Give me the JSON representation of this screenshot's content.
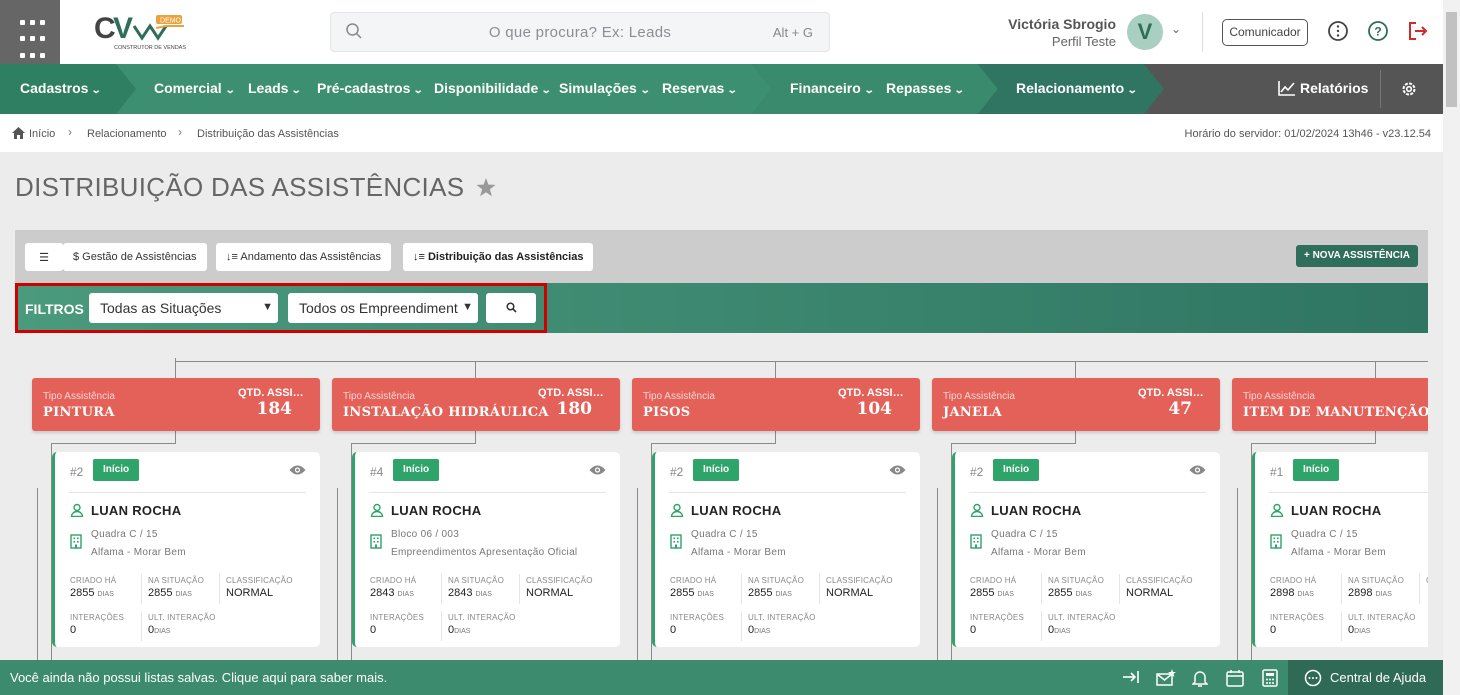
{
  "search": {
    "placeholder": "O que procura? Ex: Leads",
    "shortcut": "Alt + G"
  },
  "user": {
    "name": "Victória Sbrogio",
    "profile": "Perfil Teste",
    "initial": "V"
  },
  "header": {
    "comunicador": "Comunicador"
  },
  "nav": {
    "items": [
      "Cadastros",
      "Comercial",
      "Leads",
      "Pré-cadastros",
      "Disponibilidade",
      "Simulações",
      "Reservas",
      "Financeiro",
      "Repasses",
      "Relacionamento"
    ],
    "relatorios": "Relatórios"
  },
  "breadcrumb": [
    "Início",
    "Relacionamento",
    "Distribuição das Assistências"
  ],
  "server_time": "Horário do servidor: 01/02/2024 13h46 - v23.12.54",
  "page_title": "DISTRIBUIÇÃO DAS ASSISTÊNCIAS",
  "tabs": [
    "$ Gestão de Assistências",
    "↓≡ Andamento das Assistências",
    "↓≡ Distribuição das Assistências"
  ],
  "nova_assistencia": "+ NOVA ASSISTÊNCIA",
  "filters": {
    "label": "FILTROS",
    "situacoes": "Todas as Situações",
    "empreendimentos": "Todos os Empreendiment"
  },
  "group_labels": {
    "tipo": "Tipo Assistência",
    "qtd": "QTD. ASSISTÊNCIAS"
  },
  "metric_labels": {
    "criado": "CRIADO HÁ",
    "na_situacao": "NA SITUAÇÃO",
    "classificacao": "CLASSIFICAÇÃO",
    "interacoes": "INTERAÇÕES",
    "ult_interacao": "ULT. INTERAÇÃO",
    "dias": "DIAS"
  },
  "groups": [
    {
      "tipo": "PINTURA",
      "qtd": "184",
      "card": {
        "num": "#2",
        "status": "Início",
        "name": "LUAN ROCHA",
        "unit": "Quadra C / 15",
        "project": "Alfama - Morar Bem",
        "criado": "2855",
        "situacao": "2855",
        "classificacao": "NORMAL",
        "interacoes": "0",
        "ult": "0"
      }
    },
    {
      "tipo": "INSTALAÇÃO HIDRÁULICA",
      "qtd": "180",
      "card": {
        "num": "#4",
        "status": "Início",
        "name": "LUAN ROCHA",
        "unit": "Bloco 06 / 003",
        "project": "Empreendimentos Apresentação Oficial",
        "criado": "2843",
        "situacao": "2843",
        "classificacao": "NORMAL",
        "interacoes": "0",
        "ult": "0"
      }
    },
    {
      "tipo": "PISOS",
      "qtd": "104",
      "card": {
        "num": "#2",
        "status": "Início",
        "name": "LUAN ROCHA",
        "unit": "Quadra C / 15",
        "project": "Alfama - Morar Bem",
        "criado": "2855",
        "situacao": "2855",
        "classificacao": "NORMAL",
        "interacoes": "0",
        "ult": "0"
      }
    },
    {
      "tipo": "JANELA",
      "qtd": "47",
      "card": {
        "num": "#2",
        "status": "Início",
        "name": "LUAN ROCHA",
        "unit": "Quadra C / 15",
        "project": "Alfama - Morar Bem",
        "criado": "2855",
        "situacao": "2855",
        "classificacao": "NORMAL",
        "interacoes": "0",
        "ult": "0"
      }
    },
    {
      "tipo": "ITEM DE MANUTENÇÃO",
      "qtd": "",
      "card": {
        "num": "#1",
        "status": "Início",
        "name": "LUAN ROCHA",
        "unit": "Quadra C / 15",
        "project": "Alfama - Morar Bem",
        "criado": "2898",
        "situacao": "2898",
        "classificacao": "",
        "interacoes": "0",
        "ult": "0"
      }
    }
  ],
  "footer": {
    "message": "Você ainda não possui listas salvas. Clique aqui para saber mais.",
    "help": "Central de Ajuda"
  },
  "colors": {
    "primary": "#2f6e5b",
    "group_header": "#e46159",
    "status_green": "#2ea36a",
    "highlight_border": "#d10000"
  }
}
